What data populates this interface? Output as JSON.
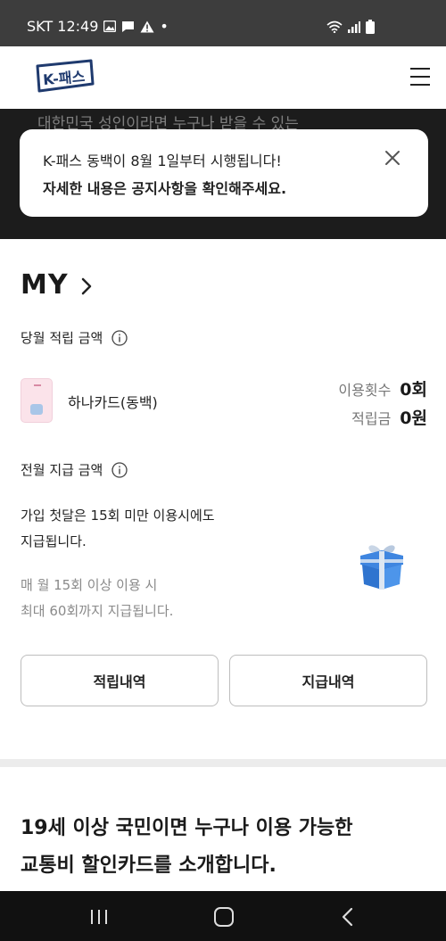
{
  "status_bar": {
    "carrier_time": "SKT 12:49",
    "dot": "•",
    "left_icons": [
      "image-icon",
      "message-icon",
      "warning-icon"
    ],
    "right_icons": [
      "wifi-icon",
      "signal-icon",
      "battery-icon"
    ]
  },
  "header": {
    "logo_text": "K-패스",
    "menu_icon": "hamburger-menu-icon"
  },
  "banner": {
    "background_text": "대한민국 성인이라면 누구나 받을 수 있는"
  },
  "notice": {
    "line1": "K-패스 동백이 8월 1일부터 시행됩니다!",
    "line2": "자세한 내용은 공지사항을 확인해주세요.",
    "close_icon": "close-icon"
  },
  "my": {
    "title": "MY",
    "current_month_label": "당월 적립 금액",
    "card_name": "하나카드(동백)",
    "usage_label": "이용횟수",
    "usage_value": "0회",
    "points_label": "적립금",
    "points_value": "0원",
    "prev_month_label": "전월 지급 금액",
    "desc_line1": "가입 첫달은 15회 미만 이용시에도",
    "desc_line2": "지급됩니다.",
    "sub_line1": "매 월 15회 이상 이용 시",
    "sub_line2": "최대 60회까지 지급됩니다.",
    "btn_history": "적립내역",
    "btn_payout": "지급내역"
  },
  "promo": {
    "line1": "19세 이상 국민이면 누구나 이용 가능한",
    "line2": "교통비 할인카드를 소개합니다."
  },
  "colors": {
    "brand_navy": "#1f3a6e",
    "banner_bg": "#1c1c1c",
    "status_bar_bg": "#3d3d3d"
  }
}
